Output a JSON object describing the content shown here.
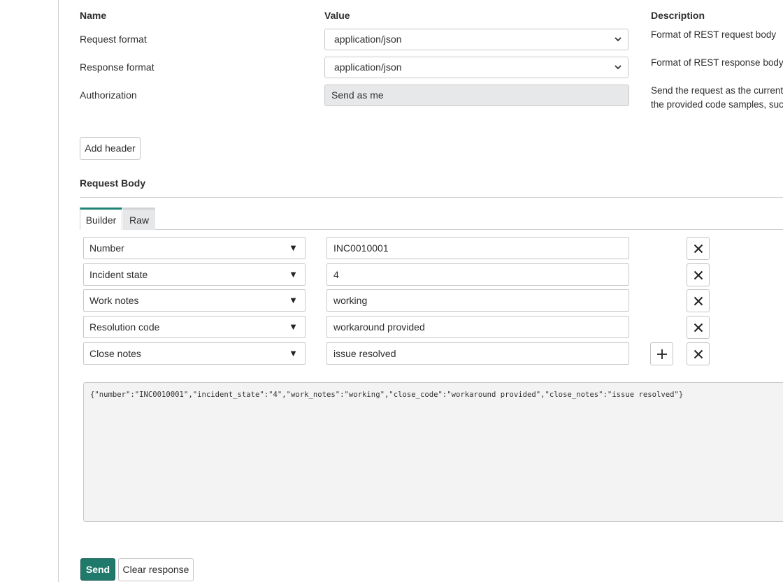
{
  "columns": {
    "name": "Name",
    "value": "Value",
    "description": "Description"
  },
  "settings": [
    {
      "label": "Request format",
      "value": "application/json",
      "description": "Format of REST request body"
    },
    {
      "label": "Response format",
      "value": "application/json",
      "description": "Format of REST response body"
    },
    {
      "label": "Authorization",
      "value": "Send as me",
      "description": "Send the request as the current u",
      "description2": "the provided code samples, such"
    }
  ],
  "add_header_label": "Add header",
  "request_body": {
    "title": "Request Body",
    "tabs": [
      "Builder",
      "Raw"
    ],
    "active_tab": "Builder",
    "fields": [
      {
        "field": "Number",
        "value": "INC0010001"
      },
      {
        "field": "Incident state",
        "value": "4"
      },
      {
        "field": "Work notes",
        "value": "working"
      },
      {
        "field": "Resolution code",
        "value": "workaround provided"
      },
      {
        "field": "Close notes",
        "value": "issue resolved"
      }
    ],
    "json_preview": "{\"number\":\"INC0010001\",\"incident_state\":\"4\",\"work_notes\":\"working\",\"close_code\":\"workaround provided\",\"close_notes\":\"issue resolved\"}"
  },
  "actions": {
    "send": "Send",
    "clear": "Clear response"
  },
  "colors": {
    "accent": "#1f7a6c",
    "tab_accent": "#1f8476"
  },
  "icons": {
    "remove": "close-icon",
    "add": "plus-icon",
    "dropdown": "chevron-down-icon",
    "field_dropdown": "triangle-down-icon"
  }
}
